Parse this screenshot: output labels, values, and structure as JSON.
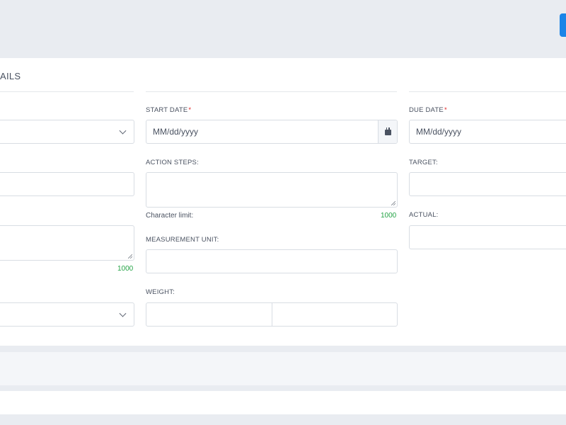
{
  "section": {
    "title": "AILS"
  },
  "start_date": {
    "label": "START DATE",
    "required_mark": "*",
    "placeholder": "MM/dd/yyyy"
  },
  "due_date": {
    "label": "DUE DATE",
    "required_mark": "*",
    "placeholder": "MM/dd/yyyy"
  },
  "action_steps": {
    "label": "ACTION STEPS:",
    "char_limit_label": "Character limit:",
    "char_remaining": "1000"
  },
  "left_textarea": {
    "char_remaining": "1000"
  },
  "target": {
    "label": "TARGET:"
  },
  "actual": {
    "label": "ACTUAL:"
  },
  "measurement_unit": {
    "label": "MEASUREMENT UNIT:"
  },
  "weight": {
    "label": "WEIGHT:"
  },
  "colors": {
    "primary": "#1b84e7",
    "success_text": "#23a345",
    "required": "#e02424"
  },
  "icons": [
    "calendar-icon",
    "chevron-down-icon",
    "resize-grip-icon"
  ]
}
